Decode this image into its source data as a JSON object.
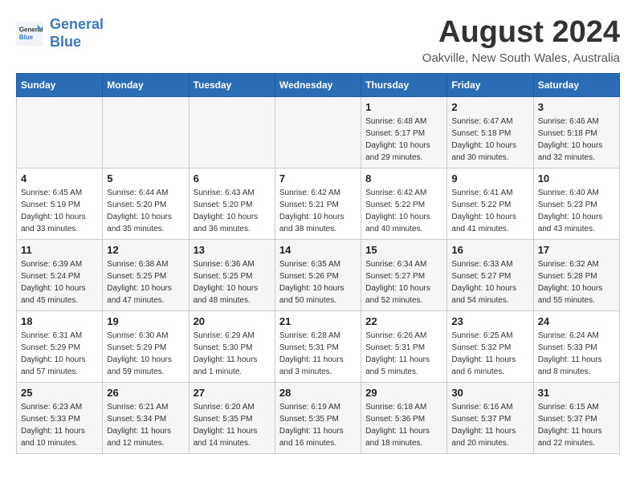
{
  "header": {
    "logo_line1": "General",
    "logo_line2": "Blue",
    "month_title": "August 2024",
    "location": "Oakville, New South Wales, Australia"
  },
  "days_of_week": [
    "Sunday",
    "Monday",
    "Tuesday",
    "Wednesday",
    "Thursday",
    "Friday",
    "Saturday"
  ],
  "weeks": [
    [
      {
        "day": "",
        "info": ""
      },
      {
        "day": "",
        "info": ""
      },
      {
        "day": "",
        "info": ""
      },
      {
        "day": "",
        "info": ""
      },
      {
        "day": "1",
        "info": "Sunrise: 6:48 AM\nSunset: 5:17 PM\nDaylight: 10 hours\nand 29 minutes."
      },
      {
        "day": "2",
        "info": "Sunrise: 6:47 AM\nSunset: 5:18 PM\nDaylight: 10 hours\nand 30 minutes."
      },
      {
        "day": "3",
        "info": "Sunrise: 6:46 AM\nSunset: 5:18 PM\nDaylight: 10 hours\nand 32 minutes."
      }
    ],
    [
      {
        "day": "4",
        "info": "Sunrise: 6:45 AM\nSunset: 5:19 PM\nDaylight: 10 hours\nand 33 minutes."
      },
      {
        "day": "5",
        "info": "Sunrise: 6:44 AM\nSunset: 5:20 PM\nDaylight: 10 hours\nand 35 minutes."
      },
      {
        "day": "6",
        "info": "Sunrise: 6:43 AM\nSunset: 5:20 PM\nDaylight: 10 hours\nand 36 minutes."
      },
      {
        "day": "7",
        "info": "Sunrise: 6:42 AM\nSunset: 5:21 PM\nDaylight: 10 hours\nand 38 minutes."
      },
      {
        "day": "8",
        "info": "Sunrise: 6:42 AM\nSunset: 5:22 PM\nDaylight: 10 hours\nand 40 minutes."
      },
      {
        "day": "9",
        "info": "Sunrise: 6:41 AM\nSunset: 5:22 PM\nDaylight: 10 hours\nand 41 minutes."
      },
      {
        "day": "10",
        "info": "Sunrise: 6:40 AM\nSunset: 5:23 PM\nDaylight: 10 hours\nand 43 minutes."
      }
    ],
    [
      {
        "day": "11",
        "info": "Sunrise: 6:39 AM\nSunset: 5:24 PM\nDaylight: 10 hours\nand 45 minutes."
      },
      {
        "day": "12",
        "info": "Sunrise: 6:38 AM\nSunset: 5:25 PM\nDaylight: 10 hours\nand 47 minutes."
      },
      {
        "day": "13",
        "info": "Sunrise: 6:36 AM\nSunset: 5:25 PM\nDaylight: 10 hours\nand 48 minutes."
      },
      {
        "day": "14",
        "info": "Sunrise: 6:35 AM\nSunset: 5:26 PM\nDaylight: 10 hours\nand 50 minutes."
      },
      {
        "day": "15",
        "info": "Sunrise: 6:34 AM\nSunset: 5:27 PM\nDaylight: 10 hours\nand 52 minutes."
      },
      {
        "day": "16",
        "info": "Sunrise: 6:33 AM\nSunset: 5:27 PM\nDaylight: 10 hours\nand 54 minutes."
      },
      {
        "day": "17",
        "info": "Sunrise: 6:32 AM\nSunset: 5:28 PM\nDaylight: 10 hours\nand 55 minutes."
      }
    ],
    [
      {
        "day": "18",
        "info": "Sunrise: 6:31 AM\nSunset: 5:29 PM\nDaylight: 10 hours\nand 57 minutes."
      },
      {
        "day": "19",
        "info": "Sunrise: 6:30 AM\nSunset: 5:29 PM\nDaylight: 10 hours\nand 59 minutes."
      },
      {
        "day": "20",
        "info": "Sunrise: 6:29 AM\nSunset: 5:30 PM\nDaylight: 11 hours\nand 1 minute."
      },
      {
        "day": "21",
        "info": "Sunrise: 6:28 AM\nSunset: 5:31 PM\nDaylight: 11 hours\nand 3 minutes."
      },
      {
        "day": "22",
        "info": "Sunrise: 6:26 AM\nSunset: 5:31 PM\nDaylight: 11 hours\nand 5 minutes."
      },
      {
        "day": "23",
        "info": "Sunrise: 6:25 AM\nSunset: 5:32 PM\nDaylight: 11 hours\nand 6 minutes."
      },
      {
        "day": "24",
        "info": "Sunrise: 6:24 AM\nSunset: 5:33 PM\nDaylight: 11 hours\nand 8 minutes."
      }
    ],
    [
      {
        "day": "25",
        "info": "Sunrise: 6:23 AM\nSunset: 5:33 PM\nDaylight: 11 hours\nand 10 minutes."
      },
      {
        "day": "26",
        "info": "Sunrise: 6:21 AM\nSunset: 5:34 PM\nDaylight: 11 hours\nand 12 minutes."
      },
      {
        "day": "27",
        "info": "Sunrise: 6:20 AM\nSunset: 5:35 PM\nDaylight: 11 hours\nand 14 minutes."
      },
      {
        "day": "28",
        "info": "Sunrise: 6:19 AM\nSunset: 5:35 PM\nDaylight: 11 hours\nand 16 minutes."
      },
      {
        "day": "29",
        "info": "Sunrise: 6:18 AM\nSunset: 5:36 PM\nDaylight: 11 hours\nand 18 minutes."
      },
      {
        "day": "30",
        "info": "Sunrise: 6:16 AM\nSunset: 5:37 PM\nDaylight: 11 hours\nand 20 minutes."
      },
      {
        "day": "31",
        "info": "Sunrise: 6:15 AM\nSunset: 5:37 PM\nDaylight: 11 hours\nand 22 minutes."
      }
    ]
  ]
}
